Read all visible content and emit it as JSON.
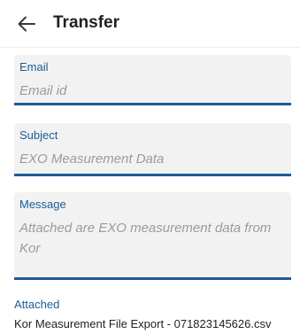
{
  "header": {
    "title": "Transfer",
    "back_icon": "arrow-left-icon"
  },
  "form": {
    "email": {
      "label": "Email",
      "placeholder": "Email id",
      "value": ""
    },
    "subject": {
      "label": "Subject",
      "value": "EXO Measurement Data"
    },
    "message": {
      "label": "Message",
      "value": "Attached are EXO measurement data from Kor"
    }
  },
  "attachment": {
    "label": "Attached",
    "filename": "Kor Measurement File Export - 071823145626.csv"
  },
  "colors": {
    "accent": "#1e5b9b",
    "label": "#1a5d96",
    "field_bg": "#f2f2f3",
    "placeholder": "#9b9b9b"
  }
}
